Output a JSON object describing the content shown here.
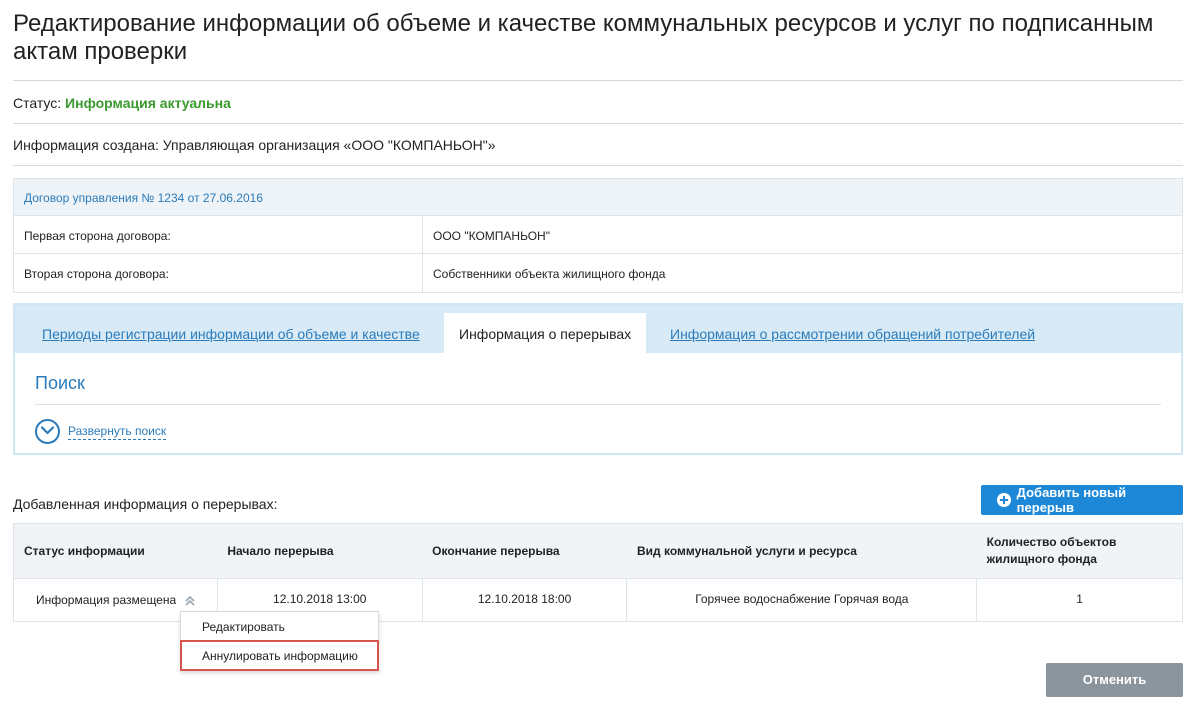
{
  "page": {
    "title": "Редактирование информации об объеме и качестве коммунальных ресурсов и услуг по подписанным актам проверки"
  },
  "status": {
    "label": "Статус:",
    "value": "Информация актуальна"
  },
  "created": {
    "text": "Информация создана: Управляющая организация «ООО \"КОМПАНЬОН\"»"
  },
  "contract": {
    "header": "Договор управления № 1234 от 27.06.2016",
    "rows": [
      {
        "label": "Первая сторона договора:",
        "value": "ООО \"КОМПАНЬОН\""
      },
      {
        "label": "Вторая сторона договора:",
        "value": "Собственники объекта жилищного фонда"
      }
    ]
  },
  "tabs": [
    {
      "label": "Периоды регистрации информации об объеме и качестве"
    },
    {
      "label": "Информация о перерывах"
    },
    {
      "label": "Информация о рассмотрении обращений потребителей"
    }
  ],
  "search": {
    "title": "Поиск",
    "expand_label": "Развернуть поиск"
  },
  "breaks": {
    "label": "Добавленная информация о перерывах:",
    "add_button": "Добавить новый перерыв",
    "columns": [
      "Статус информации",
      "Начало перерыва",
      "Окончание перерыва",
      "Вид коммунальной услуги и ресурса",
      "Количество объектов жилищного фонда"
    ],
    "rows": [
      {
        "status": "Информация размещена",
        "start": "12.10.2018 13:00",
        "end": "12.10.2018 18:00",
        "service": "Горячее водоснабжение Горячая вода",
        "count": "1"
      }
    ]
  },
  "menu": {
    "items": [
      {
        "label": "Редактировать"
      },
      {
        "label": "Аннулировать информацию"
      }
    ]
  },
  "footer": {
    "cancel": "Отменить"
  },
  "colors": {
    "accent": "#2b7bba",
    "status_ok": "#3a9a2e",
    "primary_button": "#1e88d8",
    "secondary_button": "#8b959d",
    "highlight": "#d9534f"
  }
}
